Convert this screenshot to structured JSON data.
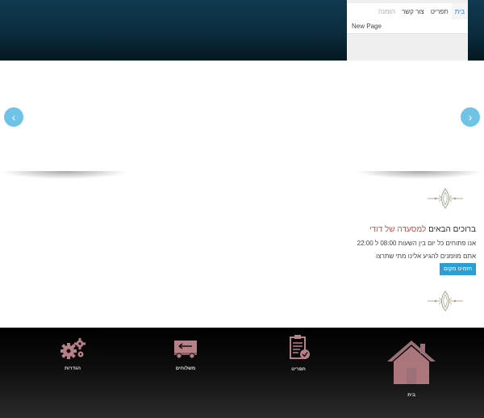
{
  "nav": {
    "tabs": [
      {
        "label": "בית",
        "active": true
      },
      {
        "label": "תפריט",
        "active": false
      },
      {
        "label": "צור קשר",
        "active": false
      },
      {
        "label": "הזמנה",
        "active": false
      }
    ],
    "submenu_item": "New Page"
  },
  "slider": {
    "prev_icon": "‹",
    "next_icon": "›"
  },
  "welcome": {
    "title_prefix": "ברוכים הבאים",
    "title_brand": "למסעדה של דודי",
    "hours": "אנו פתוחים כל יום בין השעות 08:00 ל 22:00",
    "invite": "אתם מוזמנים להגיע אלינו מתי שתרצו",
    "order_button": "הזמינו מקום"
  },
  "features": {
    "settings": "הגדרות",
    "delivery": "משלוחים",
    "menu": "תפריט",
    "home": "בית"
  },
  "colors": {
    "header_dark": "#0b2c3d",
    "accent_blue": "#2a9fd6",
    "arrow_blue": "#6fc3e6",
    "brand_red": "#d0504a",
    "icon_mauve": "#b77f86"
  },
  "icons": {
    "prev": "chevron-left-icon",
    "next": "chevron-right-icon",
    "settings": "gears-icon",
    "delivery": "truck-icon",
    "menu": "clipboard-check-icon",
    "home": "house-icon",
    "ornament": "ornament-divider-icon"
  }
}
